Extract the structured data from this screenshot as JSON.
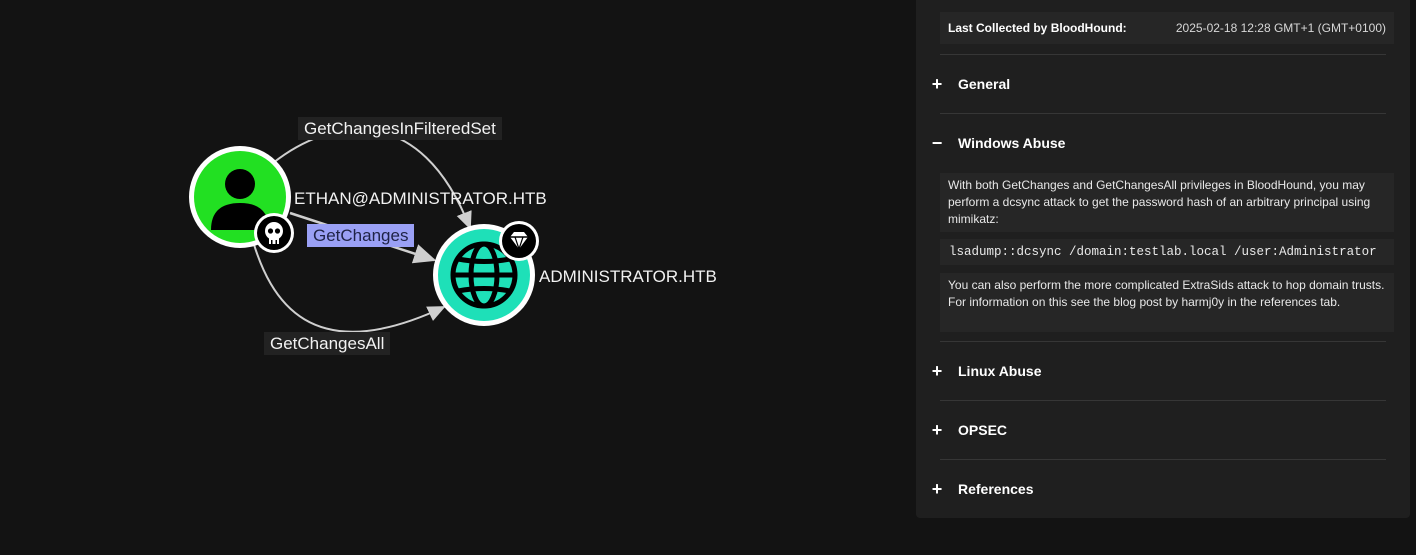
{
  "graph": {
    "edges": {
      "filtered_set": "GetChangesInFilteredSet",
      "get_changes": "GetChanges",
      "get_changes_all": "GetChangesAll"
    },
    "nodes": {
      "user": "ETHAN@ADMINISTRATOR.HTB",
      "domain": "ADMINISTRATOR.HTB"
    },
    "colors": {
      "user_node": "#22e022",
      "domain_node": "#1ee0b8",
      "selected_edge": "#9aa0f5"
    }
  },
  "panel": {
    "collected_key": "Last Collected by BloodHound:",
    "collected_value": "2025-02-18 12:28 GMT+1 (GMT+0100)",
    "sections": {
      "general": {
        "toggle": "+",
        "title": "General"
      },
      "windows": {
        "toggle": "−",
        "title": "Windows Abuse"
      },
      "linux": {
        "toggle": "+",
        "title": "Linux Abuse"
      },
      "opsec": {
        "toggle": "+",
        "title": "OPSEC"
      },
      "references": {
        "toggle": "+",
        "title": "References"
      }
    },
    "windows_abuse": {
      "text1": "With both GetChanges and GetChangesAll privileges in BloodHound, you may perform a dcsync attack to get the password hash of an arbitrary principal using mimikatz:",
      "command": "lsadump::dcsync /domain:testlab.local /user:Administrator",
      "text2": "You can also perform the more complicated ExtraSids attack to hop domain trusts. For information on this see the blog post by harmj0y in the references tab."
    }
  }
}
